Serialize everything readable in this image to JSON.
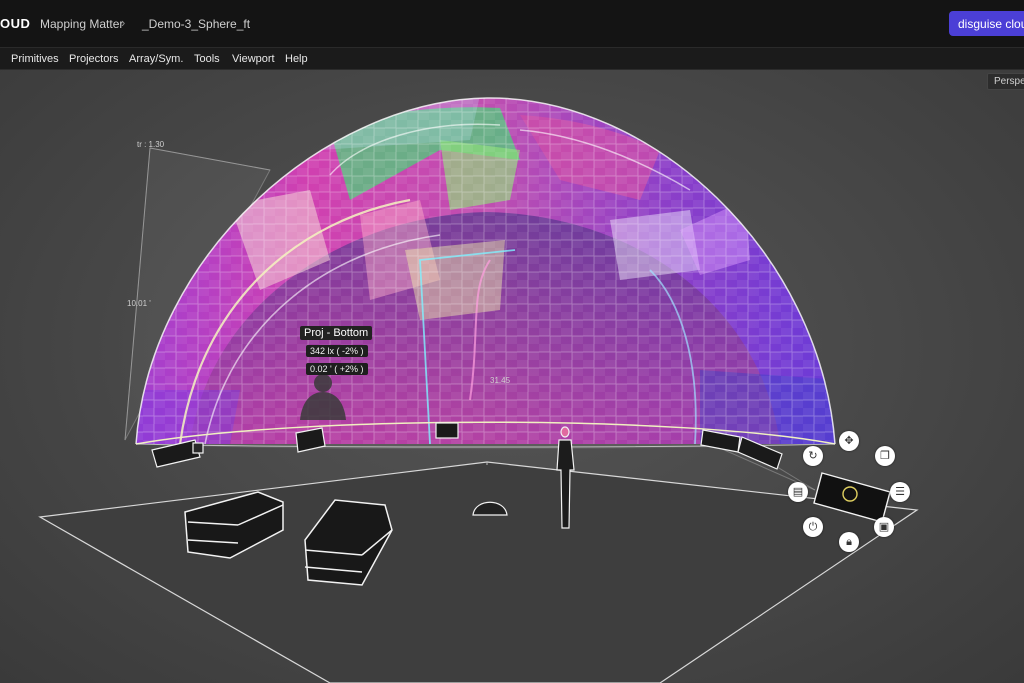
{
  "header": {
    "brand": "OUD",
    "breadcrumb": [
      "Mapping Matter",
      "_Demo-3_Sphere_ft"
    ],
    "separator": "›",
    "cta_label": "disguise cloud"
  },
  "menu": [
    "Primitives",
    "Projectors",
    "Array/Sym.",
    "Tools",
    "Viewport",
    "Help"
  ],
  "viewport": {
    "view_mode": "Perspe",
    "throw_ratio_label": "tr : 1.30",
    "distance_label": "10.01 '",
    "floor_label": "31.45"
  },
  "tooltip": {
    "title": "Proj - Bottom",
    "line1": "342 lx ( -2% )",
    "line2": "0.02 ' ( +2% )"
  },
  "gizmo_icons": [
    "move-icon",
    "rotate-icon",
    "duplicate-icon",
    "adjust-icon",
    "image-icon",
    "lock-icon",
    "power-icon",
    "properties-icon"
  ],
  "colors": {
    "accent": "#4b3fd6",
    "grid": "#ffffff"
  }
}
